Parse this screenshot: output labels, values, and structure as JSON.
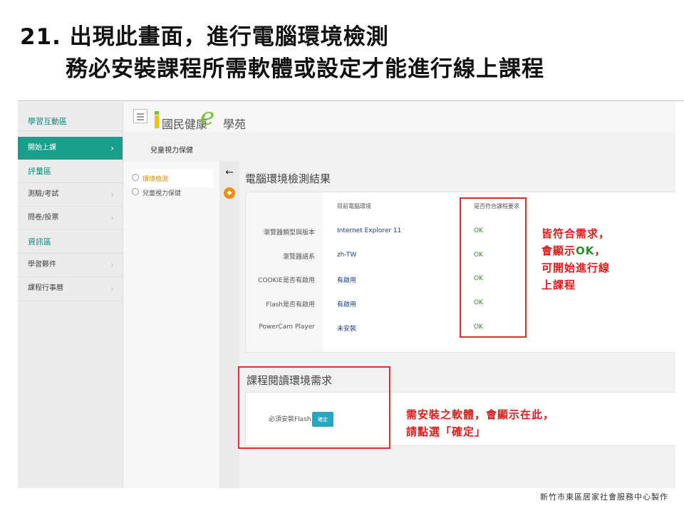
{
  "slide": {
    "title_line1": "21. 出現此畫面，進行電腦環境檢測",
    "title_line2": "務必安裝課程所需軟體或設定才能進行線上課程",
    "footer": "新竹市東區居家社會服務中心製作"
  },
  "app": {
    "logo_text_left": "國民健康",
    "logo_e": "e",
    "logo_text_right": "學苑",
    "course_name": "兒童視力保健"
  },
  "sidebar": {
    "header": "學習互動區",
    "start_course": "開始上課",
    "section_eval": "評量區",
    "eval_items": [
      "測驗/考試",
      "問卷/投票"
    ],
    "section_info": "資訊區",
    "info_items": [
      "學習夥件",
      "課程行事曆"
    ]
  },
  "left_panel": {
    "items": [
      "環境檢測",
      "兒童視力保健"
    ],
    "active_index": 0
  },
  "result": {
    "title": "電腦環境檢測結果",
    "col_current": "目前電腦環境",
    "col_meets": "是否符合課程要求",
    "rows": [
      {
        "label": "瀏覽器類型與版本",
        "value": "Internet Explorer 11",
        "status": "OK"
      },
      {
        "label": "瀏覽器語系",
        "value": "zh-TW",
        "status": "OK"
      },
      {
        "label": "COOKIE是否有啟用",
        "value": "有啟用",
        "status": "OK"
      },
      {
        "label": "Flash是否有啟用",
        "value": "有啟用",
        "status": "OK"
      },
      {
        "label": "PowerCam Player",
        "value": "未安裝",
        "status": "OK"
      }
    ]
  },
  "requirements": {
    "title": "課程閱讀環境需求",
    "item_label": "必須安裝Flash",
    "confirm_button": "確定"
  },
  "annotations": {
    "ok_note_pre": "皆符合需求，\n會顯示",
    "ok_note_ok": "OK",
    "ok_note_post": "，\n可開始進行線\n上課程",
    "install_note": "需安裝之軟體，會顯示在此，\n請點選「確定」",
    "annotation_color": "#e11a1a"
  }
}
